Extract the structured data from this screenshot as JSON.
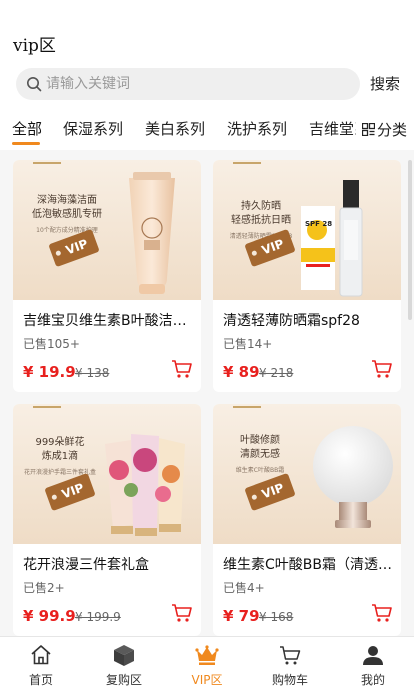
{
  "header": {
    "title": "vip区"
  },
  "search": {
    "placeholder": "请输入关键词",
    "value": "",
    "button_label": "搜索"
  },
  "tabs": [
    {
      "label": "全部",
      "active": true
    },
    {
      "label": "保湿系列"
    },
    {
      "label": "美白系列"
    },
    {
      "label": "洗护系列"
    },
    {
      "label": "吉维堂系列"
    }
  ],
  "category_button": {
    "label": "分类",
    "icon": "grid-icon"
  },
  "products": [
    {
      "name": "吉维宝贝维生素B叶酸洁面乳",
      "sold": "已售105+",
      "price": "¥ 19.9",
      "original_price": "¥ 138",
      "image_caption": [
        "深海海藻洁面",
        "低泡敏感肌专研"
      ],
      "image_note": "10个配方成分精准护理",
      "badge": "VIP",
      "bar_color": "#c8a56a"
    },
    {
      "name": "清透轻薄防晒霜spf28",
      "sold": "已售14+",
      "price": "¥ 89",
      "original_price": "¥ 218",
      "image_caption": [
        "持久防晒",
        "轻感抵抗日晒"
      ],
      "image_note": "清透轻薄防晒霜SPF 28",
      "badge": "VIP",
      "bottle_label": "SPF 28",
      "bar_color": "#c8a56a"
    },
    {
      "name": "花开浪漫三件套礼盒",
      "sold": "已售2+",
      "price": "¥ 99.9",
      "original_price": "¥ 199.9",
      "image_caption": [
        "999朵鲜花",
        "炼成1滴"
      ],
      "image_note": "花开浪漫护手霜三件套礼盒",
      "badge": "VIP",
      "bar_color": "#c8a56a"
    },
    {
      "name": "维生素C叶酸BB霜（清透款）",
      "sold": "已售4+",
      "price": "¥ 79",
      "original_price": "¥ 168",
      "image_caption": [
        "叶酸修颜",
        "清颜无感"
      ],
      "image_note": "维生素C叶酸BB霜",
      "badge": "VIP",
      "bar_color": "#c8a56a"
    }
  ],
  "tabbar": [
    {
      "label": "首页",
      "icon": "home-icon"
    },
    {
      "label": "复购区",
      "icon": "box-icon"
    },
    {
      "label": "VIP区",
      "icon": "crown-icon",
      "active": true
    },
    {
      "label": "购物车",
      "icon": "cart-icon"
    },
    {
      "label": "我的",
      "icon": "user-icon"
    }
  ],
  "colors": {
    "accent": "#f0891e",
    "price": "#e8201e",
    "badge": "#a4672f",
    "image_bg": "#f4e8da"
  }
}
